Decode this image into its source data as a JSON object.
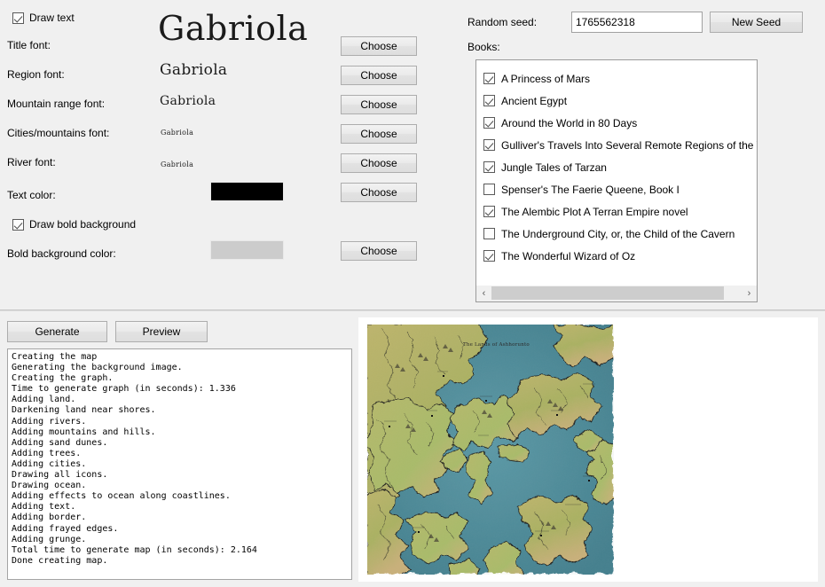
{
  "app": {
    "background_color": "#f0f0f0"
  },
  "text_settings": {
    "draw_text": {
      "label": "Draw text",
      "checked": true
    },
    "rows": [
      {
        "label": "Title font:",
        "sample": "Gabriola",
        "button": "Choose"
      },
      {
        "label": "Region font:",
        "sample": "Gabriola",
        "button": "Choose"
      },
      {
        "label": "Mountain range font:",
        "sample": "Gabriola",
        "button": "Choose"
      },
      {
        "label": "Cities/mountains font:",
        "sample": "Gabriola",
        "button": "Choose"
      },
      {
        "label": "River font:",
        "sample": "Gabriola",
        "button": "Choose"
      }
    ],
    "text_color": {
      "label": "Text color:",
      "value": "#000000",
      "button": "Choose"
    },
    "draw_bold_background": {
      "label": "Draw bold background",
      "checked": true
    },
    "bold_background_color": {
      "label": "Bold background color:",
      "value": "#cccccc",
      "button": "Choose"
    }
  },
  "seed": {
    "label": "Random seed:",
    "value": "1765562318",
    "placeholder": "",
    "new_seed_button": "New Seed"
  },
  "books": {
    "label": "Books:",
    "items": [
      {
        "title": "A Princess of Mars",
        "checked": true
      },
      {
        "title": "Ancient Egypt",
        "checked": true
      },
      {
        "title": "Around the World in 80 Days",
        "checked": true
      },
      {
        "title": "Gulliver's Travels Into Several Remote Regions of the World",
        "checked": true
      },
      {
        "title": "Jungle Tales of Tarzan",
        "checked": true
      },
      {
        "title": "Spenser's The Faerie Queene, Book I",
        "checked": false
      },
      {
        "title": "The Alembic Plot A Terran Empire novel",
        "checked": true
      },
      {
        "title": "The Underground City, or, the Child of the Cavern",
        "checked": false
      },
      {
        "title": "The Wonderful Wizard of Oz",
        "checked": true
      }
    ],
    "scrollbar": {
      "left_arrow": "‹",
      "right_arrow": "›"
    }
  },
  "actions": {
    "generate_button": "Generate",
    "preview_button": "Preview"
  },
  "log": {
    "lines": [
      "Creating the map",
      "Generating the background image.",
      "Creating the graph.",
      "Time to generate graph (in seconds): 1.336",
      "Adding land.",
      "Darkening land near shores.",
      "Adding rivers.",
      "Adding mountains and hills.",
      "Adding sand dunes.",
      "Adding trees.",
      "Adding cities.",
      "Drawing all icons.",
      "Drawing ocean.",
      "Adding effects to ocean along coastlines.",
      "Adding text.",
      "Adding border.",
      "Adding frayed edges.",
      "Adding grunge.",
      "Total time to generate map (in seconds): 2.164",
      "Done creating map."
    ],
    "text": "Creating the map\nGenerating the background image.\nCreating the graph.\nTime to generate graph (in seconds): 1.336\nAdding land.\nDarkening land near shores.\nAdding rivers.\nAdding mountains and hills.\nAdding sand dunes.\nAdding trees.\nAdding cities.\nDrawing all icons.\nDrawing ocean.\nAdding effects to ocean along coastlines.\nAdding text.\nAdding border.\nAdding frayed edges.\nAdding grunge.\nTotal time to generate map (in seconds): 2.164\nDone creating map."
  },
  "map_preview": {
    "title_text": "The Lands of Ashhorunto",
    "ocean_color": "#4e8b99",
    "land_color": "#b0b064",
    "land_color_alt": "#c9b278",
    "land_color_green": "#a8b768",
    "coast_line_color": "#1c1c1c"
  }
}
